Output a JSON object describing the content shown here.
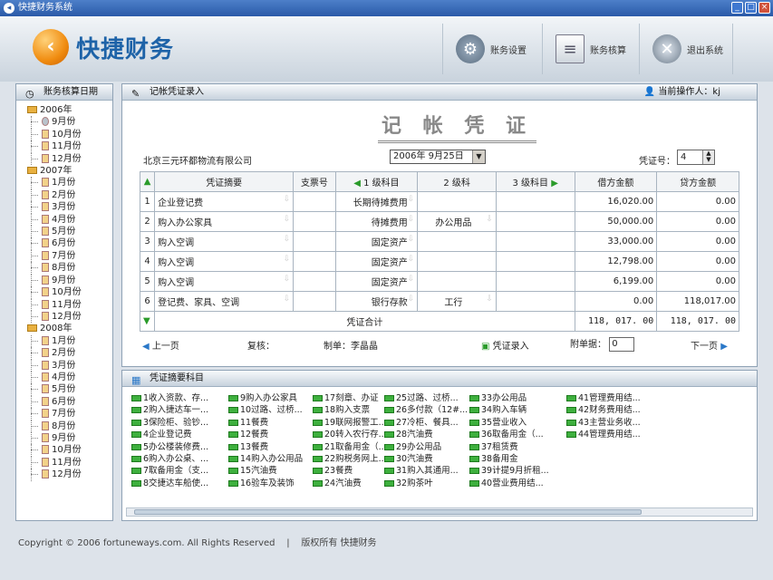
{
  "window": {
    "title": "快捷财务系统"
  },
  "header": {
    "logo_text": "快捷财务",
    "btn_settings": "账务设置",
    "btn_audit": "账务核算",
    "btn_exit": "退出系统"
  },
  "sidebar": {
    "title": "账务核算日期",
    "years": [
      {
        "year": "2006年",
        "months": [
          "9月份",
          "10月份",
          "11月份",
          "12月份"
        ]
      },
      {
        "year": "2007年",
        "months": [
          "1月份",
          "2月份",
          "3月份",
          "4月份",
          "5月份",
          "6月份",
          "7月份",
          "8月份",
          "9月份",
          "10月份",
          "11月份",
          "12月份"
        ]
      },
      {
        "year": "2008年",
        "months": [
          "1月份",
          "2月份",
          "3月份",
          "4月份",
          "5月份",
          "6月份",
          "7月份",
          "8月份",
          "9月份",
          "10月份",
          "11月份",
          "12月份"
        ]
      }
    ]
  },
  "voucher": {
    "panel_title": "记帐凭证录入",
    "operator_label": "当前操作人：kj",
    "title": "记 帐 凭 证",
    "company": "北京三元环都物流有限公司",
    "date": "2006年 9月25日",
    "voucher_no_label": "凭证号：",
    "voucher_no": "4",
    "columns": [
      "凭证摘要",
      "支票号",
      "1 级科目",
      "2 级科",
      "3 级科目",
      "借方金额",
      "贷方金额"
    ],
    "rows": [
      {
        "no": "1",
        "summary": "企业登记费",
        "check": "",
        "l1": "长期待摊费用",
        "l2": "",
        "l3": "",
        "debit": "16,020.00",
        "credit": "0.00"
      },
      {
        "no": "2",
        "summary": "购入办公家具",
        "check": "",
        "l1": "待摊费用",
        "l2": "办公用品",
        "l3": "",
        "debit": "50,000.00",
        "credit": "0.00"
      },
      {
        "no": "3",
        "summary": "购入空调",
        "check": "",
        "l1": "固定资产",
        "l2": "",
        "l3": "",
        "debit": "33,000.00",
        "credit": "0.00"
      },
      {
        "no": "4",
        "summary": "购入空调",
        "check": "",
        "l1": "固定资产",
        "l2": "",
        "l3": "",
        "debit": "12,798.00",
        "credit": "0.00"
      },
      {
        "no": "5",
        "summary": "购入空调",
        "check": "",
        "l1": "固定资产",
        "l2": "",
        "l3": "",
        "debit": "6,199.00",
        "credit": "0.00"
      },
      {
        "no": "6",
        "summary": "登记费、家具、空调",
        "check": "",
        "l1": "银行存款",
        "l2": "工行",
        "l3": "",
        "debit": "0.00",
        "credit": "118,017.00"
      }
    ],
    "total_label": "凭证合计",
    "total_debit": "118, 017. 00",
    "total_credit": "118, 017. 00",
    "prev_page": "上一页",
    "review_label": "复核：",
    "maker_label": "制单：李晶晶",
    "entry_btn": "凭证录入",
    "attach_label": "附单据：",
    "attach_value": "0",
    "next_page": "下一页"
  },
  "subjects": {
    "panel_title": "凭证摘要科目",
    "columns": [
      [
        "1收入资款、存...",
        "2购入捷达车一...",
        "3保险柜、验钞...",
        "4企业登记费",
        "5办公楼装修费...",
        "6购入办公桌、...",
        "7取备用金（支...",
        "8交捷达车船使..."
      ],
      [
        "9购入办公家具",
        "10过路、过桥...",
        "11餐费",
        "12餐费",
        "13餐费",
        "14购入办公用品",
        "15汽油费",
        "16验车及装饰"
      ],
      [
        "17刻章、办证",
        "18购入支票",
        "19联网报警工...",
        "20转入农行存...",
        "21取备用金（...",
        "22购税务网上...",
        "23餐费",
        "24汽油费"
      ],
      [
        "25过路、过桥...",
        "26多付款（12#...",
        "27冷柜、餐具...",
        "28汽油费",
        "29办公用品",
        "30汽油费",
        "31购入其通用...",
        "32购茶叶"
      ],
      [
        "33办公用品",
        "34购入车辆",
        "35营业收入",
        "36取备用金（...",
        "37租赁费",
        "38备用金",
        "39计提9月折租...",
        "40营业费用结..."
      ],
      [
        "41管理费用结...",
        "42财务费用结...",
        "43主营业务收...",
        "44管理费用结..."
      ]
    ]
  },
  "footer": {
    "copyright": "Copyright © 2006 fortuneways.com. All Rights Reserved",
    "sep": "|",
    "rights": "版权所有 快捷财务"
  }
}
